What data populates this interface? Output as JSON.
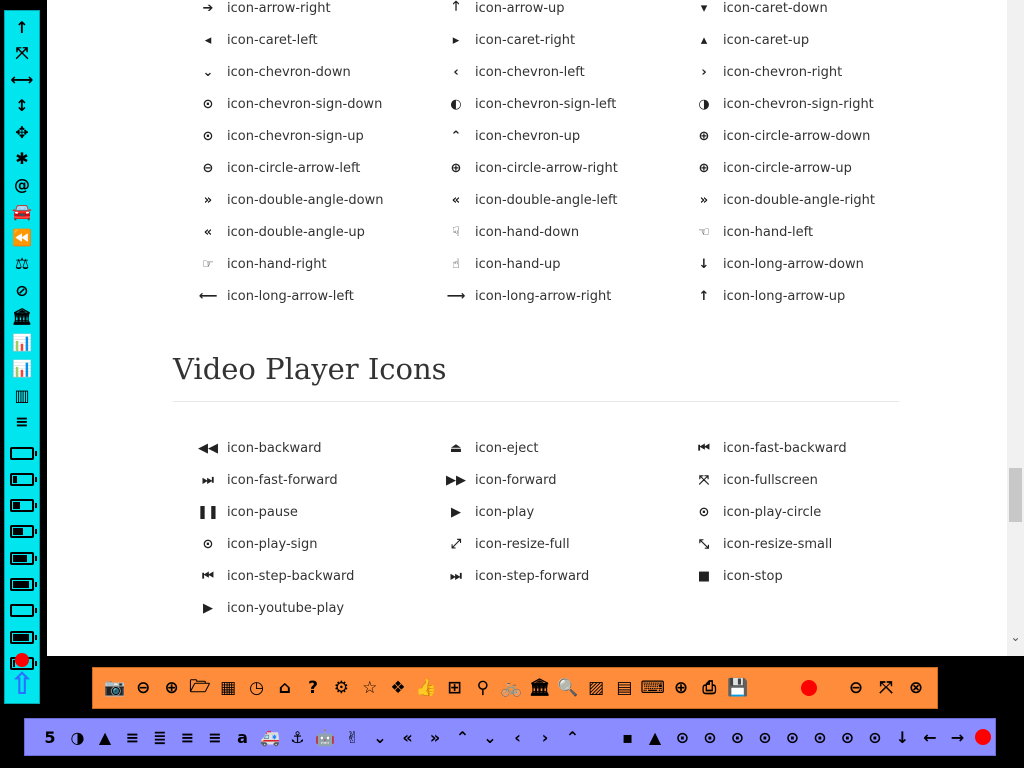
{
  "direction_icons": [
    [
      "icon-arrow-right",
      "icon-arrow-up",
      "icon-caret-down"
    ],
    [
      "icon-caret-left",
      "icon-caret-right",
      "icon-caret-up"
    ],
    [
      "icon-chevron-down",
      "icon-chevron-left",
      "icon-chevron-right"
    ],
    [
      "icon-chevron-sign-down",
      "icon-chevron-sign-left",
      "icon-chevron-sign-right"
    ],
    [
      "icon-chevron-sign-up",
      "icon-chevron-up",
      "icon-circle-arrow-down"
    ],
    [
      "icon-circle-arrow-left",
      "icon-circle-arrow-right",
      "icon-circle-arrow-up"
    ],
    [
      "icon-double-angle-down",
      "icon-double-angle-left",
      "icon-double-angle-right"
    ],
    [
      "icon-double-angle-up",
      "icon-hand-down",
      "icon-hand-left"
    ],
    [
      "icon-hand-right",
      "icon-hand-up",
      "icon-long-arrow-down"
    ],
    [
      "icon-long-arrow-left",
      "icon-long-arrow-right",
      "icon-long-arrow-up"
    ]
  ],
  "direction_glyphs": [
    [
      "➔",
      "🡑",
      "▾"
    ],
    [
      "◂",
      "▸",
      "▴"
    ],
    [
      "⌄",
      "‹",
      "›"
    ],
    [
      "⊙",
      "◐",
      "◑"
    ],
    [
      "⊙",
      "⌃",
      "⊕"
    ],
    [
      "⊖",
      "⊕",
      "⊕"
    ],
    [
      "»",
      "«",
      "»"
    ],
    [
      "«",
      "☟",
      "☜"
    ],
    [
      "☞",
      "☝",
      "↓"
    ],
    [
      "⟵",
      "⟶",
      "↑"
    ]
  ],
  "video_heading": "Video Player Icons",
  "video_icons": [
    [
      "icon-backward",
      "icon-eject",
      "icon-fast-backward"
    ],
    [
      "icon-fast-forward",
      "icon-forward",
      "icon-fullscreen"
    ],
    [
      "icon-pause",
      "icon-play",
      "icon-play-circle"
    ],
    [
      "icon-play-sign",
      "icon-resize-full",
      "icon-resize-small"
    ],
    [
      "icon-step-backward",
      "icon-step-forward",
      "icon-stop"
    ],
    [
      "icon-youtube-play"
    ]
  ],
  "video_glyphs": [
    [
      "◀◀",
      "⏏",
      "⏮"
    ],
    [
      "⏭",
      "▶▶",
      "⤧"
    ],
    [
      "❚❚",
      "▶",
      "⊙"
    ],
    [
      "⊙",
      "⤢",
      "⤡"
    ],
    [
      "⏮",
      "⏭",
      "■"
    ],
    [
      "▶"
    ]
  ],
  "left_toolbar": {
    "glyphs_top": [
      "↑",
      "⤧",
      "⟷",
      "↕",
      "✥",
      "✱",
      "@",
      "🚘",
      "⏪",
      "⚖",
      "⊘",
      "🏛",
      "📊",
      "📊",
      "▥",
      "≡"
    ],
    "battery_fills": [
      0,
      0.25,
      0.45,
      0.65,
      0.85,
      1,
      0,
      1,
      0.15
    ],
    "big_arrow": "⇧"
  },
  "orange_toolbar": {
    "glyphs": [
      "📷",
      "⊖",
      "⊕",
      "🗁",
      "▦",
      "◷",
      "⌂",
      "?",
      "⚙",
      "☆",
      "❖",
      "👍",
      "⊞",
      "⚲",
      "🚲",
      "🏛",
      "🔍",
      "▨",
      "▤",
      "⌨",
      "⊕",
      "⎙",
      "💾"
    ],
    "right_glyphs": [
      "⊖",
      "⤧",
      "⊗"
    ]
  },
  "purple_toolbar": {
    "glyphs": [
      "5",
      "◑",
      "▲",
      "≡",
      "≣",
      "≡",
      "≡",
      "a",
      "🚑",
      "⚓",
      "🤖",
      "✌",
      "⌄",
      "«",
      "»",
      "⌃",
      "⌄",
      "‹",
      "›",
      "⌃",
      "",
      "▪",
      "▲",
      "⊙",
      "⊙",
      "⊙",
      "⊙",
      "⊙",
      "⊙",
      "⊙",
      "⊙",
      "↓",
      "←",
      "→"
    ]
  },
  "colors": {
    "left_toolbar_bg": "#00e5ee",
    "orange_toolbar_bg": "#ff8c3a",
    "purple_toolbar_bg": "#8a8cff",
    "record_red": "#ff0000"
  }
}
